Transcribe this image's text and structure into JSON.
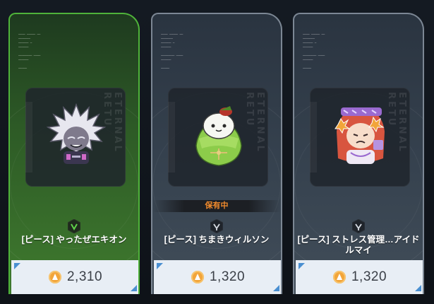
{
  "cards": [
    {
      "title": "[ピース] やったぜエキオン",
      "price": "2,310",
      "rarity_icon": "v-rarity-icon",
      "owned_label": "",
      "vertical_text": "ETERNAL RETU",
      "accent": "#4fb33a"
    },
    {
      "title": "[ピース] ちまきウィルソン",
      "price": "1,320",
      "rarity_icon": "rarity-icon",
      "owned_label": "保有中",
      "vertical_text": "ETERNAL RETU",
      "accent": "#f08a2c"
    },
    {
      "title": "[ピース] ストレス管理…アイドルマイ",
      "price": "1,320",
      "rarity_icon": "rarity-icon",
      "owned_label": "",
      "vertical_text": "ETERNAL RETU",
      "accent": "#7c8794"
    }
  ],
  "currency_icon": "coin-icon"
}
